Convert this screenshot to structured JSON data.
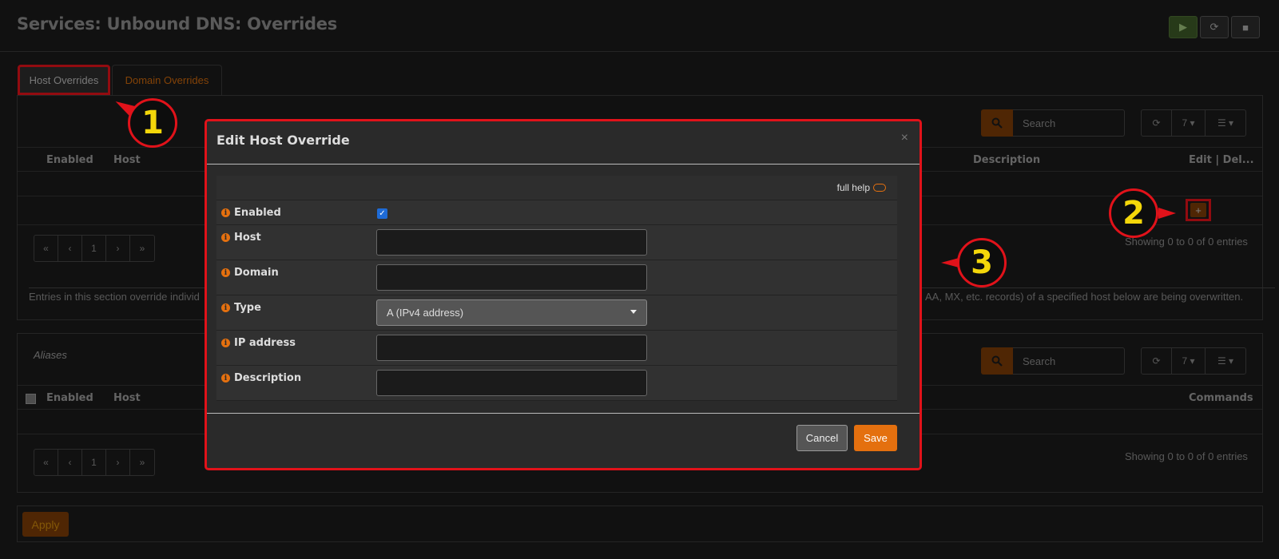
{
  "page": {
    "title": "Services: Unbound DNS: Overrides"
  },
  "service_controls": {
    "start_icon": "play-icon",
    "restart_icon": "refresh-icon",
    "stop_icon": "stop-icon"
  },
  "tabs": [
    {
      "label": "Host Overrides"
    },
    {
      "label": "Domain Overrides"
    }
  ],
  "host_section": {
    "search_placeholder": "Search",
    "rows_count": "7",
    "columns": [
      "Enabled",
      "Host",
      "Description",
      "Edit | Del..."
    ],
    "pager": [
      "«",
      "‹",
      "1",
      "›",
      "»"
    ],
    "info": "Showing 0 to 0 of 0 entries",
    "note_left": "Entries in this section override individ",
    "note_right": "AA, MX, etc. records) of a specified host below are being overwritten."
  },
  "aliases_section": {
    "title": "Aliases",
    "search_placeholder": "Search",
    "rows_count": "7",
    "columns": [
      "Enabled",
      "Host",
      "Commands"
    ],
    "pager": [
      "«",
      "‹",
      "1",
      "›",
      "»"
    ],
    "info": "Showing 0 to 0 of 0 entries"
  },
  "apply_label": "Apply",
  "modal": {
    "title": "Edit Host Override",
    "close": "×",
    "full_help": "full help",
    "fields": {
      "enabled": "Enabled",
      "host": "Host",
      "domain": "Domain",
      "type": "Type",
      "type_value": "A (IPv4 address)",
      "ip": "IP address",
      "description": "Description"
    },
    "cancel": "Cancel",
    "save": "Save"
  },
  "callouts": [
    "1",
    "2",
    "3"
  ],
  "colors": {
    "accent": "#e4700f",
    "highlight": "#e1121a",
    "callout_text": "#f4d70a"
  }
}
